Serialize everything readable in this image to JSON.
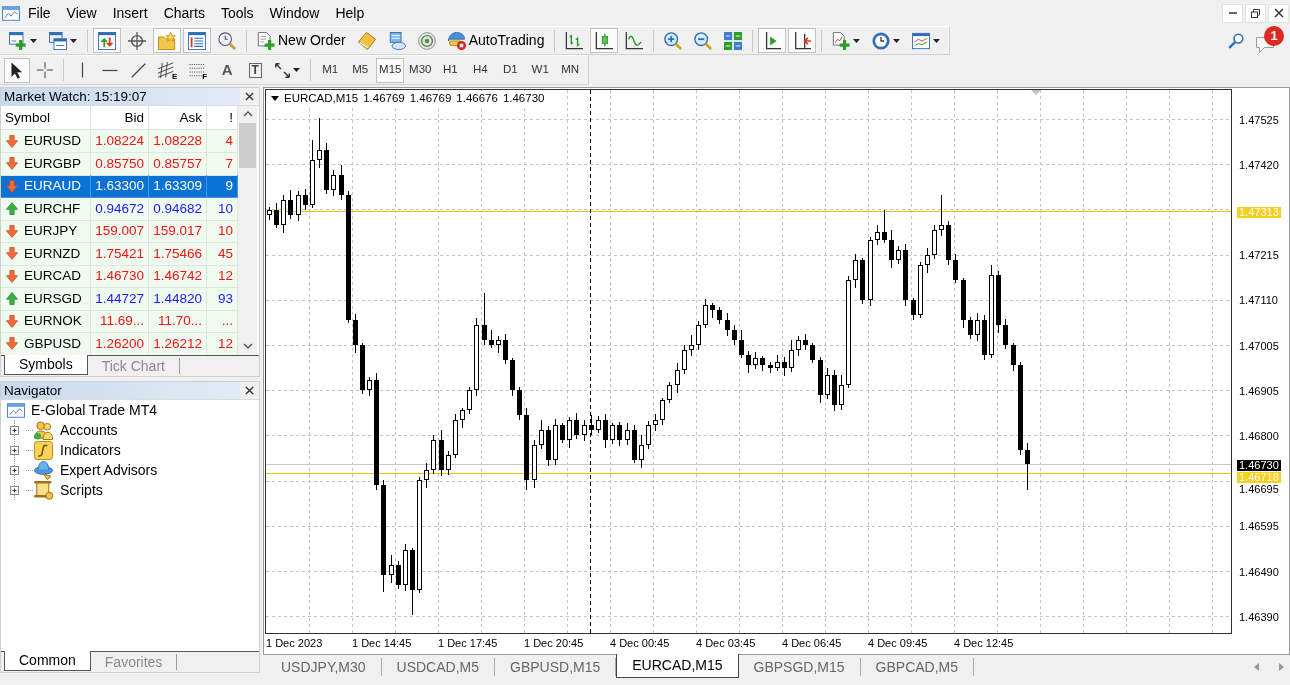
{
  "menu_bar": {
    "items": [
      "File",
      "View",
      "Insert",
      "Charts",
      "Tools",
      "Window",
      "Help"
    ]
  },
  "toolbar": {
    "groups": [
      [
        {
          "kind": "newchart",
          "on": false,
          "caret": true
        },
        {
          "kind": "profiles",
          "on": false,
          "caret": true
        }
      ],
      [
        {
          "kind": "marketwatch",
          "on": true
        },
        {
          "kind": "datawindow",
          "on": false
        },
        {
          "kind": "navigator",
          "on": true
        },
        {
          "kind": "terminal",
          "on": true
        },
        {
          "kind": "tester",
          "on": false
        }
      ],
      [
        {
          "kind": "neworder",
          "on": false,
          "label": "New Order"
        },
        {
          "kind": "metaeditor",
          "on": false
        },
        {
          "kind": "options",
          "on": false
        },
        {
          "kind": "signals",
          "on": false
        },
        {
          "kind": "autotrading",
          "on": false,
          "label": "AutoTrading"
        }
      ],
      [
        {
          "kind": "barchart",
          "on": false
        },
        {
          "kind": "candles",
          "on": true
        },
        {
          "kind": "linechart",
          "on": false
        }
      ],
      [
        {
          "kind": "zoomin",
          "on": false
        },
        {
          "kind": "zoomout",
          "on": false
        },
        {
          "kind": "tile",
          "on": false
        }
      ],
      [
        {
          "kind": "shift",
          "on": true
        },
        {
          "kind": "autoscroll",
          "on": true
        }
      ],
      [
        {
          "kind": "indicators",
          "on": false,
          "caret": true
        },
        {
          "kind": "periods",
          "on": false,
          "caret": true
        },
        {
          "kind": "templates",
          "on": false,
          "caret": true
        }
      ]
    ],
    "notification_badge": "1"
  },
  "drawing_toolbar": {
    "groups": [
      [
        {
          "kind": "cursor",
          "on": true
        },
        {
          "kind": "crosshair",
          "on": false
        }
      ],
      [
        {
          "kind": "vline",
          "on": false
        },
        {
          "kind": "hline",
          "on": false
        },
        {
          "kind": "trendline",
          "on": false
        },
        {
          "kind": "channel",
          "on": false,
          "letter": "E"
        },
        {
          "kind": "fibo",
          "on": false,
          "letter": "F"
        },
        {
          "kind": "text",
          "on": false,
          "letter": "A"
        },
        {
          "kind": "label",
          "on": false,
          "letter": "T"
        },
        {
          "kind": "arrows",
          "on": false,
          "caret": true
        }
      ]
    ],
    "timeframes": [
      {
        "label": "M1",
        "selected": false
      },
      {
        "label": "M5",
        "selected": false
      },
      {
        "label": "M15",
        "selected": true
      },
      {
        "label": "M30",
        "selected": false
      },
      {
        "label": "H1",
        "selected": false
      },
      {
        "label": "H4",
        "selected": false
      },
      {
        "label": "D1",
        "selected": false
      },
      {
        "label": "W1",
        "selected": false
      },
      {
        "label": "MN",
        "selected": false
      }
    ]
  },
  "market_watch": {
    "title": "Market Watch: 15:19:07",
    "columns": [
      "Symbol",
      "Bid",
      "Ask",
      "!"
    ],
    "rows": [
      {
        "symbol": "EURUSD",
        "bid": "1.08224",
        "ask": "1.08228",
        "spread": "4",
        "up": false,
        "selected": false
      },
      {
        "symbol": "EURGBP",
        "bid": "0.85750",
        "ask": "0.85757",
        "spread": "7",
        "up": false,
        "selected": false
      },
      {
        "symbol": "EURAUD",
        "bid": "1.63300",
        "ask": "1.63309",
        "spread": "9",
        "up": false,
        "selected": true
      },
      {
        "symbol": "EURCHF",
        "bid": "0.94672",
        "ask": "0.94682",
        "spread": "10",
        "up": true,
        "selected": false
      },
      {
        "symbol": "EURJPY",
        "bid": "159.007",
        "ask": "159.017",
        "spread": "10",
        "up": false,
        "selected": false
      },
      {
        "symbol": "EURNZD",
        "bid": "1.75421",
        "ask": "1.75466",
        "spread": "45",
        "up": false,
        "selected": false
      },
      {
        "symbol": "EURCAD",
        "bid": "1.46730",
        "ask": "1.46742",
        "spread": "12",
        "up": false,
        "selected": false
      },
      {
        "symbol": "EURSGD",
        "bid": "1.44727",
        "ask": "1.44820",
        "spread": "93",
        "up": true,
        "selected": false
      },
      {
        "symbol": "EURNOK",
        "bid": "11.69...",
        "ask": "11.70...",
        "spread": "...",
        "up": false,
        "selected": false
      },
      {
        "symbol": "GBPUSD",
        "bid": "1.26200",
        "ask": "1.26212",
        "spread": "12",
        "up": false,
        "selected": false
      }
    ],
    "tabs": [
      {
        "label": "Symbols",
        "selected": true
      },
      {
        "label": "Tick Chart",
        "selected": false
      }
    ]
  },
  "navigator": {
    "title": "Navigator",
    "root": {
      "label": "E-Global Trade MT4",
      "children": [
        {
          "label": "Accounts",
          "kind": "accounts",
          "expanded": false
        },
        {
          "label": "Indicators",
          "kind": "indicators",
          "expanded": false
        },
        {
          "label": "Expert Advisors",
          "kind": "experts",
          "expanded": false
        },
        {
          "label": "Scripts",
          "kind": "scripts",
          "expanded": false
        }
      ]
    },
    "tabs": [
      {
        "label": "Common",
        "selected": true
      },
      {
        "label": "Favorites",
        "selected": false
      }
    ]
  },
  "chart": {
    "header": {
      "symbol": "EURCAD,M15",
      "prices": [
        "1.46769",
        "1.46769",
        "1.46676",
        "1.46730"
      ]
    },
    "price_axis": [
      "1.47525",
      "1.47420",
      "1.47215",
      "1.47110",
      "1.47005",
      "1.46905",
      "1.46800",
      "1.46695",
      "1.46595",
      "1.46490",
      "1.46390"
    ],
    "price_lines": [
      {
        "kind": "level",
        "label": "1.47313"
      },
      {
        "kind": "bid",
        "label": "1.46730"
      },
      {
        "kind": "level",
        "label": "1.46718"
      }
    ],
    "time_axis": [
      "1 Dec 2023",
      "1 Dec 14:45",
      "1 Dec 17:45",
      "1 Dec 20:45",
      "4 Dec 00:45",
      "4 Dec 03:45",
      "4 Dec 06:45",
      "4 Dec 09:45",
      "4 Dec 12:45"
    ],
    "tabs": [
      {
        "label": "USDJPY,M30",
        "selected": false
      },
      {
        "label": "USDCAD,M5",
        "selected": false
      },
      {
        "label": "GBPUSD,M15",
        "selected": false
      },
      {
        "label": "EURCAD,M15",
        "selected": true
      },
      {
        "label": "GBPSGD,M15",
        "selected": false
      },
      {
        "label": "GBPCAD,M5",
        "selected": false
      }
    ]
  }
}
